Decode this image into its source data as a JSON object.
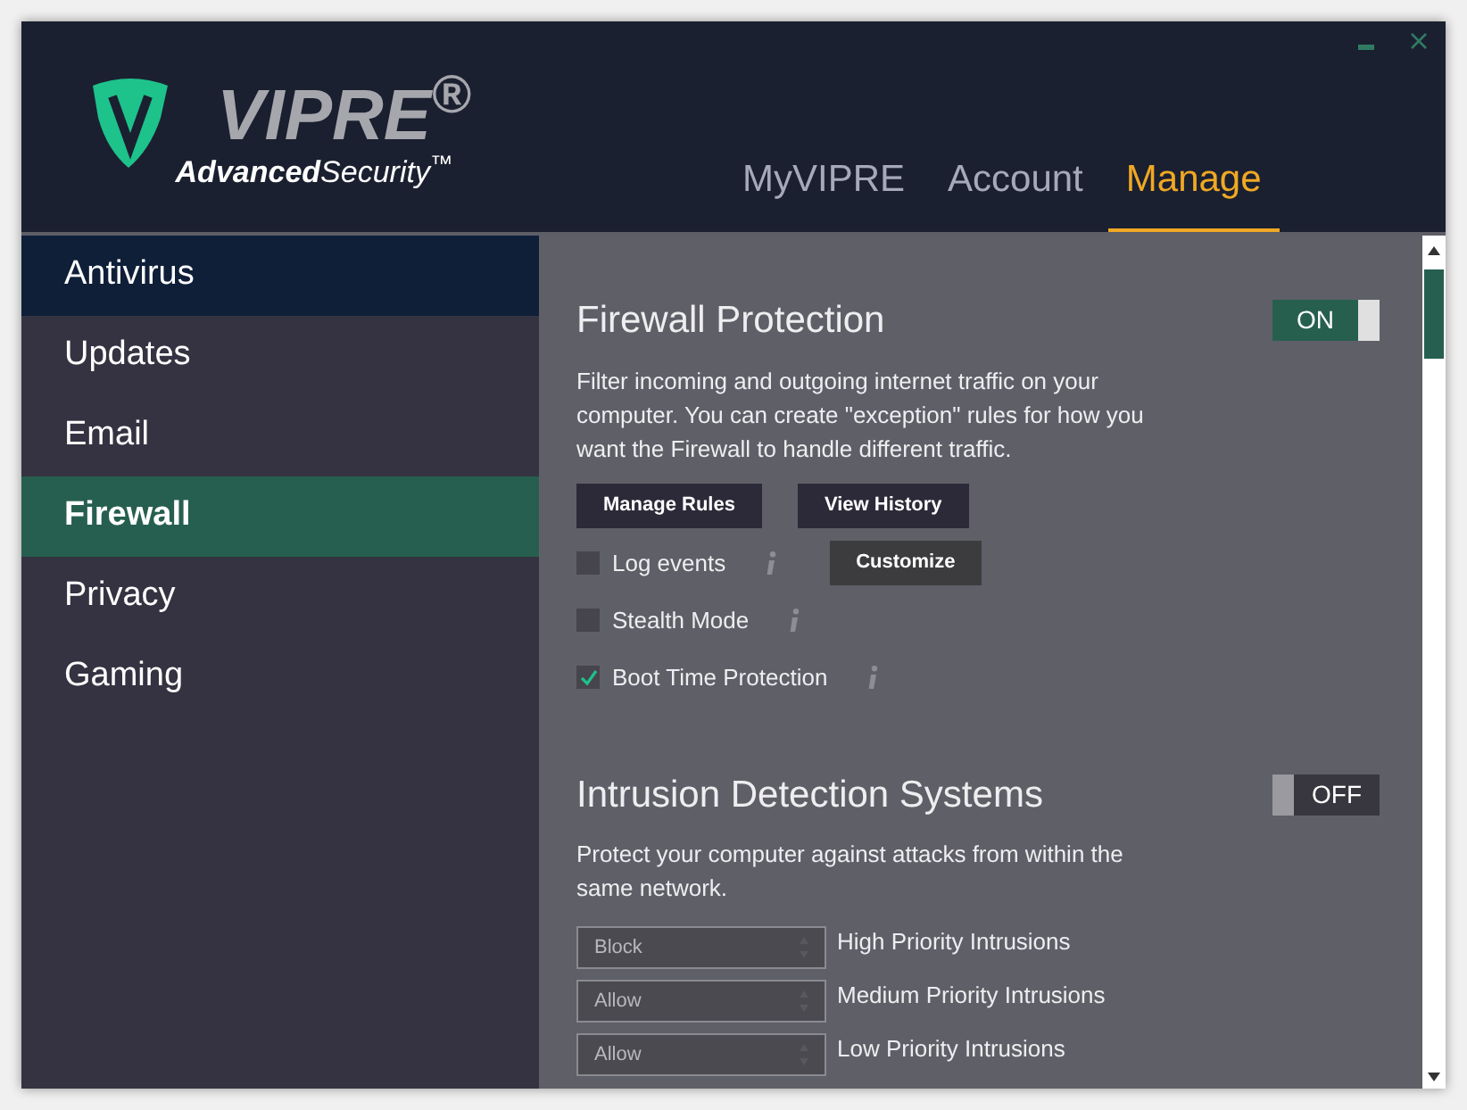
{
  "logo": {
    "wordmark": "VIPRE$^{®}$",
    "tagline": "**Advanced**Security$^{™}$"
  },
  "tabs": [
    {
      "label": "MyVIPRE",
      "selected": false
    },
    {
      "label": "Account",
      "selected": false
    },
    {
      "label": "Manage",
      "selected": true
    }
  ],
  "sidebar": {
    "items": [
      {
        "label": "Antivirus",
        "selected": false,
        "hovered": true
      },
      {
        "label": "Updates",
        "selected": false,
        "hovered": false
      },
      {
        "label": "Email",
        "selected": false,
        "hovered": false
      },
      {
        "label": "Firewall",
        "selected": true,
        "hovered": false
      },
      {
        "label": "Privacy",
        "selected": false,
        "hovered": false
      },
      {
        "label": "Gaming",
        "selected": false,
        "hovered": false
      }
    ]
  },
  "firewall": {
    "title": "Firewall Protection",
    "toggle": {
      "label": "ON",
      "on": true
    },
    "description": "Filter incoming and outgoing internet traffic on your computer. You can create \"exception\" rules for how you want the Firewall to handle different traffic.",
    "buttons": [
      "Manage Rules",
      "View History"
    ],
    "options": [
      {
        "label": "Log events",
        "checked": false,
        "button": "Customize"
      },
      {
        "label": "Stealth Mode",
        "checked": false
      },
      {
        "label": "Boot Time Protection",
        "checked": true
      }
    ]
  },
  "intrusion": {
    "title": "Intrusion Detection Systems",
    "toggle": {
      "label": "OFF",
      "on": false
    },
    "description": "Protect your computer against attacks from within the same network.",
    "rules": [
      {
        "value": "Block",
        "label": "High Priority Intrusions"
      },
      {
        "value": "Allow",
        "label": "Medium Priority Intrusions"
      },
      {
        "value": "Allow",
        "label": "Low Priority Intrusions"
      }
    ]
  }
}
